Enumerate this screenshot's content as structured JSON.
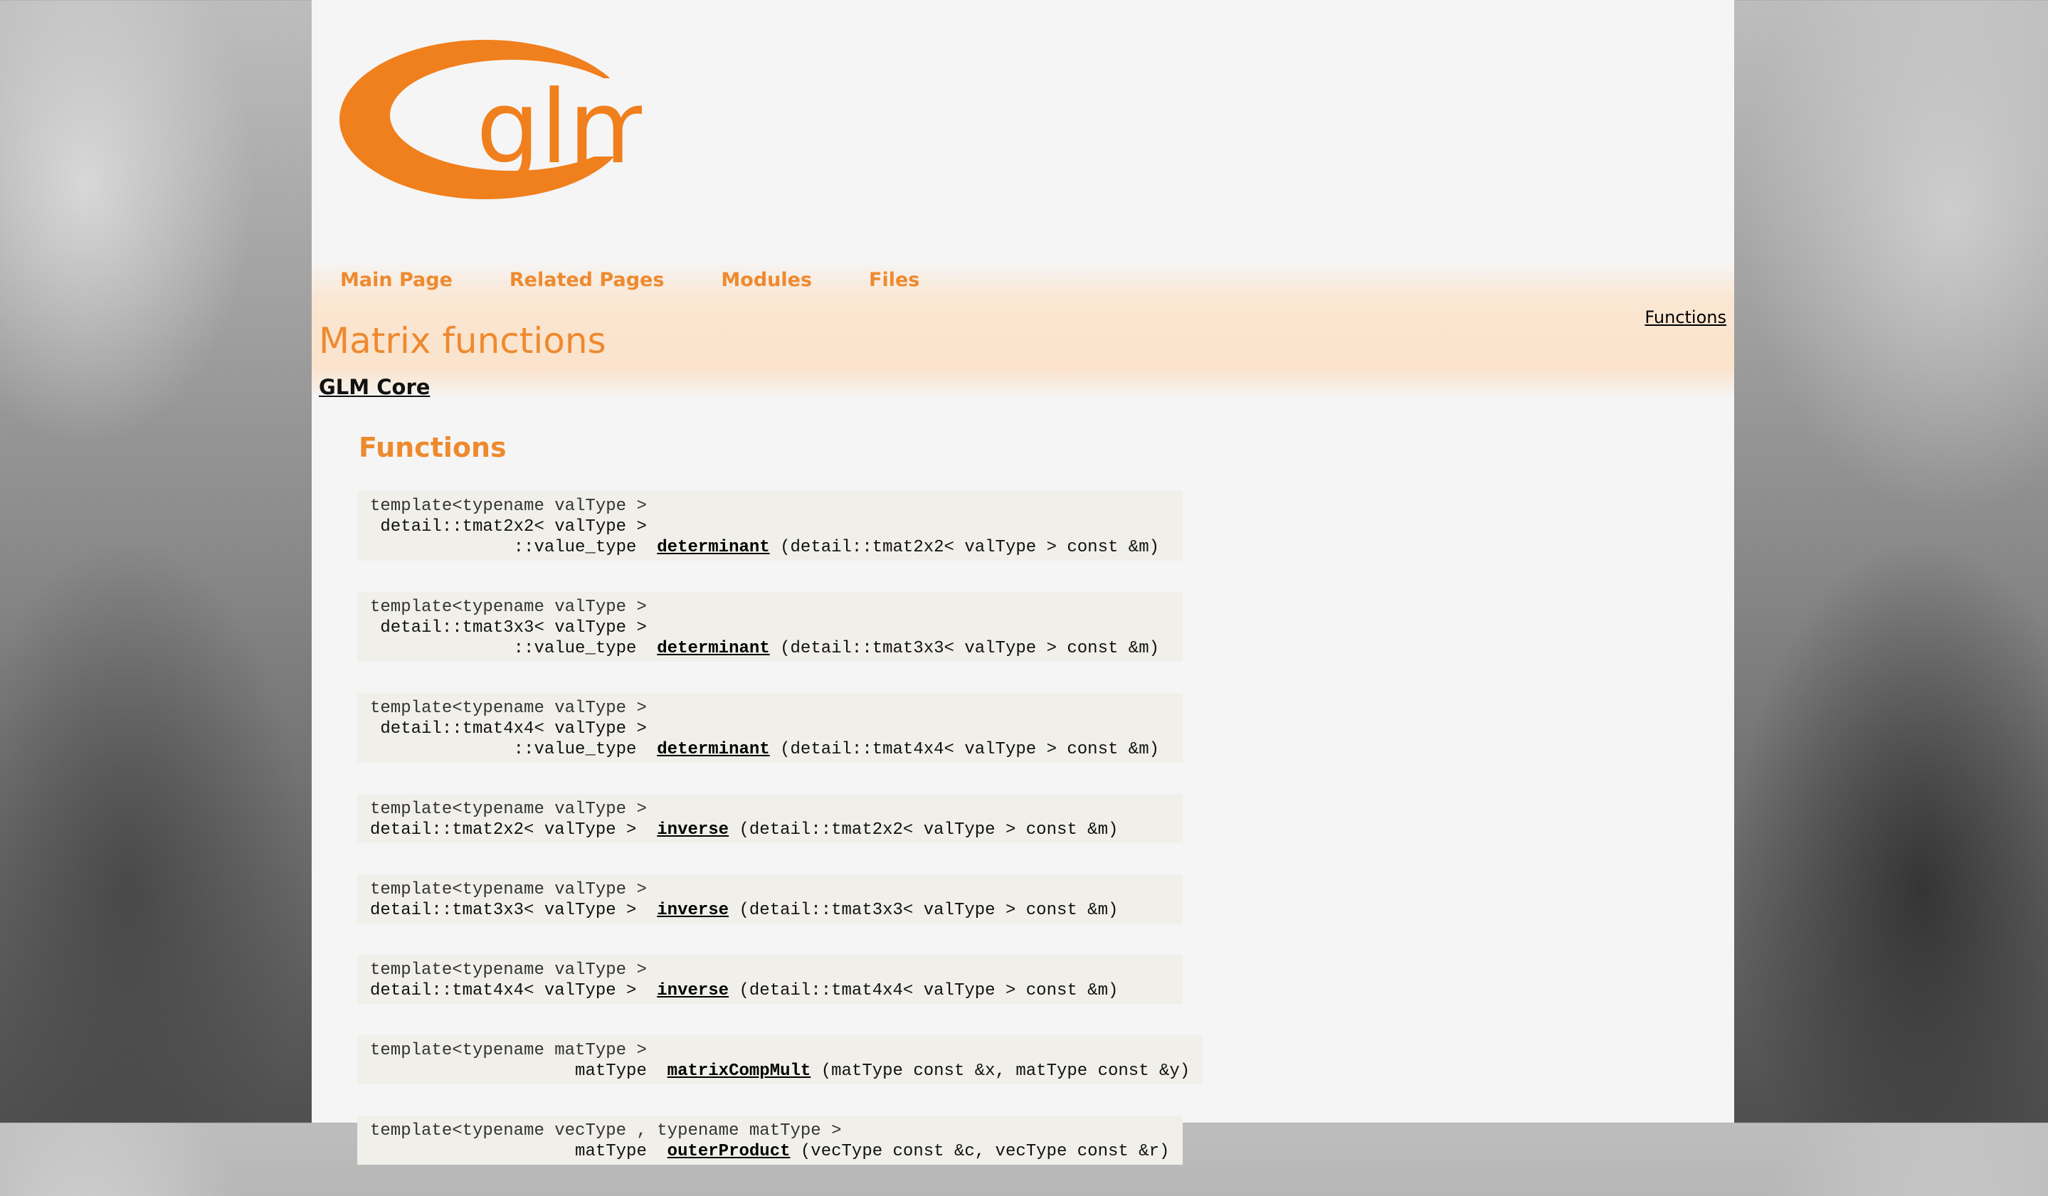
{
  "logo": {
    "text": "glm",
    "color": "#f07f1d"
  },
  "nav": {
    "tabs": [
      "Main Page",
      "Related Pages",
      "Modules",
      "Files"
    ],
    "summary_link": "Functions"
  },
  "title": "Matrix functions",
  "group": "GLM Core",
  "section_title": "Functions",
  "functions": [
    {
      "template": "template<typename valType >",
      "ret_lines": [
        " detail::tmat2x2< valType >",
        "              ::value_type  "
      ],
      "name": "determinant",
      "args": " (detail::tmat2x2< valType > const &m)"
    },
    {
      "template": "template<typename valType >",
      "ret_lines": [
        " detail::tmat3x3< valType >",
        "              ::value_type  "
      ],
      "name": "determinant",
      "args": " (detail::tmat3x3< valType > const &m)"
    },
    {
      "template": "template<typename valType >",
      "ret_lines": [
        " detail::tmat4x4< valType >",
        "              ::value_type  "
      ],
      "name": "determinant",
      "args": " (detail::tmat4x4< valType > const &m)"
    },
    {
      "template": "template<typename valType >",
      "ret_lines": [
        "detail::tmat2x2< valType >  "
      ],
      "name": "inverse",
      "args": " (detail::tmat2x2< valType > const &m)"
    },
    {
      "template": "template<typename valType >",
      "ret_lines": [
        "detail::tmat3x3< valType >  "
      ],
      "name": "inverse",
      "args": " (detail::tmat3x3< valType > const &m)"
    },
    {
      "template": "template<typename valType >",
      "ret_lines": [
        "detail::tmat4x4< valType >  "
      ],
      "name": "inverse",
      "args": " (detail::tmat4x4< valType > const &m)"
    },
    {
      "template": "template<typename matType >",
      "ret_lines": [
        "                    matType  "
      ],
      "name": "matrixCompMult",
      "args": " (matType const &x, matType const &y)"
    },
    {
      "template": "template<typename vecType , typename matType >",
      "ret_lines": [
        "                    matType  "
      ],
      "name": "outerProduct",
      "args": " (vecType const &c, vecType const &r)"
    }
  ]
}
